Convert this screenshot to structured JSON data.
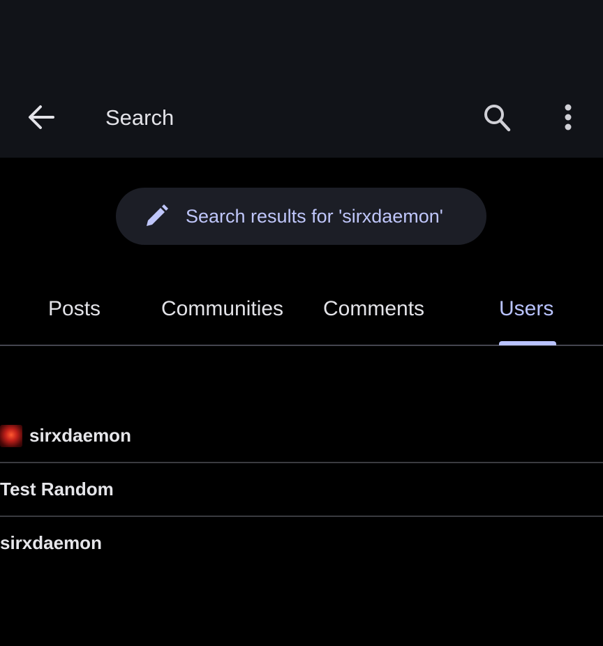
{
  "header": {
    "title": "Search",
    "back_icon": "arrow-left-icon",
    "search_icon": "search-icon",
    "more_icon": "more-vertical-icon"
  },
  "search_chip": {
    "icon": "pencil-icon",
    "label": "Search results for 'sirxdaemon'"
  },
  "tabs": [
    {
      "label": "Posts",
      "active": false
    },
    {
      "label": "Communities",
      "active": false
    },
    {
      "label": "Comments",
      "active": false
    },
    {
      "label": "Users",
      "active": true
    }
  ],
  "results": [
    {
      "name": "sirxdaemon",
      "has_avatar": true
    },
    {
      "name": "Test Random",
      "has_avatar": false
    },
    {
      "name": "sirxdaemon",
      "has_avatar": false
    }
  ],
  "colors": {
    "accent": "#b9c3ff",
    "topbar_bg": "#111318",
    "background": "#000000",
    "chip_bg": "#1c1e26"
  }
}
